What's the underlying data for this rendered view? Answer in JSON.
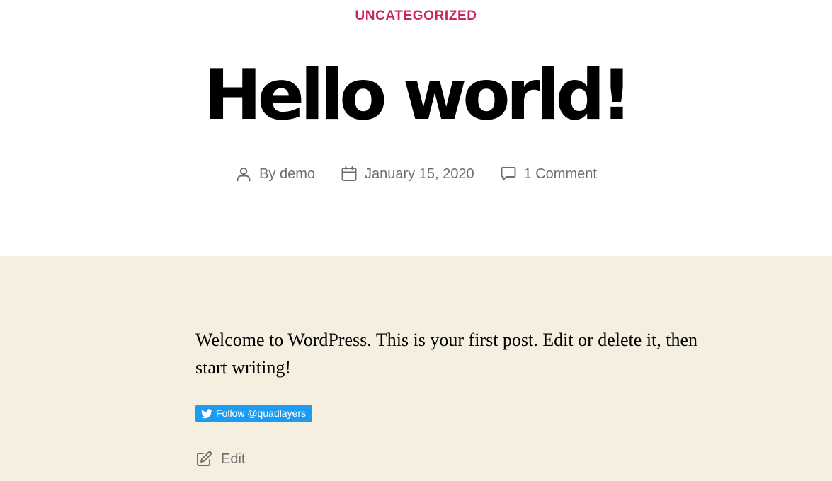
{
  "post": {
    "category": "UNCATEGORIZED",
    "title": "Hello world!",
    "meta": {
      "author": "By demo",
      "date": "January 15, 2020",
      "comments": "1 Comment"
    },
    "body": "Welcome to WordPress. This is your first post. Edit or delete it, then start writing!",
    "follow_label": "Follow @quadlayers",
    "edit_label": "Edit"
  },
  "colors": {
    "accent": "#cd2653",
    "meta_text": "#6d6d6d",
    "content_bg": "#f5efe0",
    "twitter_blue": "#1d9bf0"
  },
  "icons": {
    "author": "user-icon",
    "date": "calendar-icon",
    "comments": "comment-bubble-icon",
    "follow": "twitter-bird-icon",
    "edit": "edit-pencil-icon"
  }
}
